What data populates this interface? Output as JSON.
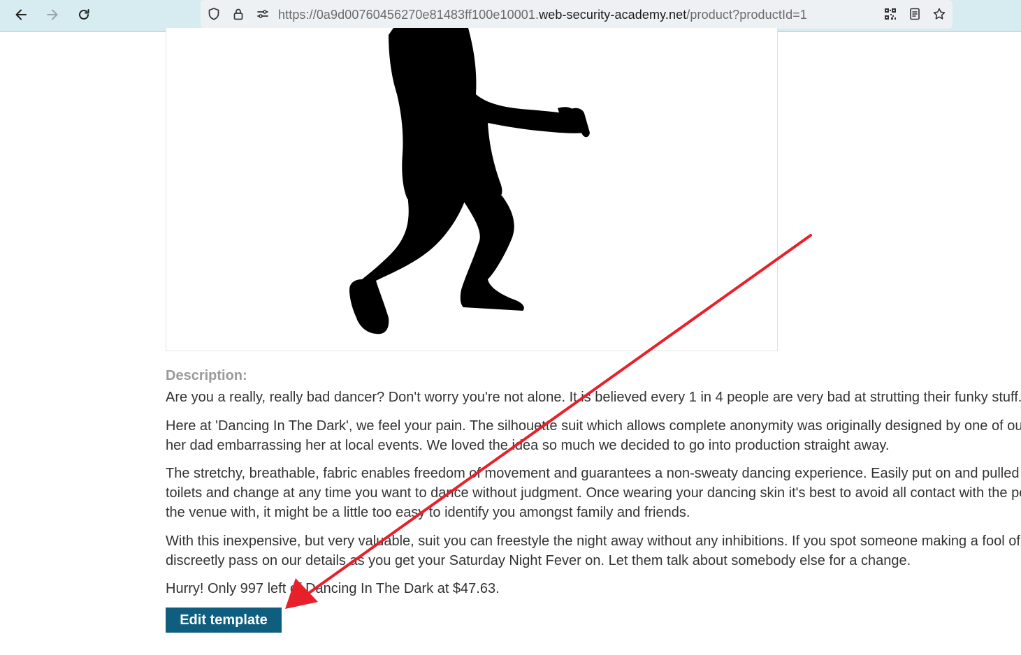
{
  "browser": {
    "url_prefix": "https://0a9d00760456270e81483ff100e10001.",
    "url_domain": "web-security-academy.net",
    "url_path": "/product?productId=1"
  },
  "product": {
    "description_label": "Description:",
    "paragraphs": [
      [
        "Are you a really, really bad dancer? Don't worry you're not alone. It is believed every 1 in 4 people are very bad at strutting their funky stuff."
      ],
      [
        "Here at 'Dancing In The Dark', we feel your pain. The silhouette suit which allows complete anonymity was originally designed by one of ou",
        "her dad embarrassing her at local events. We loved the idea so much we decided to go into production straight away."
      ],
      [
        "The stretchy, breathable, fabric enables freedom of movement and guarantees a non-sweaty dancing experience. Easily put on and pulled",
        "toilets and change at any time you want to dance without judgment. Once wearing your dancing skin it's best to avoid all contact with the pe",
        "the venue with, it might be a little too easy to identify you amongst family and friends."
      ],
      [
        "With this inexpensive, but very valuable, suit you can freestyle the night away without any inhibitions. If you spot someone making a fool of",
        "discreetly pass on our details as you get your Saturday Night Fever on. Let them talk about somebody else for a change."
      ],
      [
        "Hurry! Only 997 left of Dancing In The Dark at $47.63."
      ]
    ],
    "edit_button_label": "Edit template"
  },
  "icons": {
    "back": "arrow-left-icon",
    "forward": "arrow-right-icon",
    "reload": "reload-icon",
    "tracking": "shield-icon",
    "lock": "lock-icon",
    "permissions": "permissions-icon",
    "qr": "qr-code-icon",
    "reader": "reader-view-icon",
    "bookmark": "star-icon"
  },
  "colors": {
    "toolbar_bg": "#d6ecf0",
    "button_bg": "#0f5e7f",
    "annotation_arrow": "#e8202a",
    "label_gray": "#9a9a9a"
  }
}
